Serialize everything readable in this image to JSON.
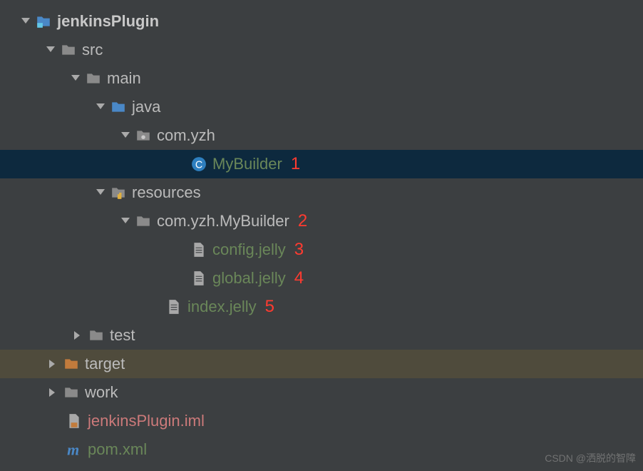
{
  "tree": {
    "jenkinsPlugin": "jenkinsPlugin",
    "src": "src",
    "main": "main",
    "java": "java",
    "com_yzh": "com.yzh",
    "MyBuilder": "MyBuilder",
    "resources": "resources",
    "com_yzh_MyBuilder": "com.yzh.MyBuilder",
    "config_jelly": "config.jelly",
    "global_jelly": "global.jelly",
    "index_jelly": "index.jelly",
    "test": "test",
    "target": "target",
    "work": "work",
    "iml": "jenkinsPlugin.iml",
    "pom": "pom.xml"
  },
  "annotations": {
    "a1": "1",
    "a2": "2",
    "a3": "3",
    "a4": "4",
    "a5": "5"
  },
  "watermark": "CSDN @洒脱的智障"
}
